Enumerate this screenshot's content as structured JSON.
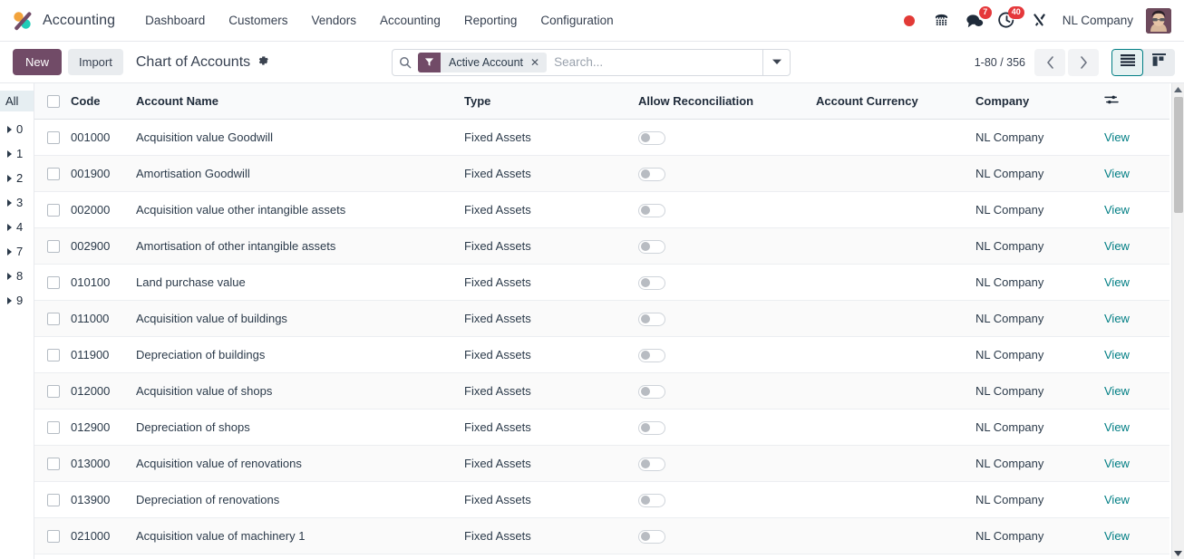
{
  "navbar": {
    "brand": "Accounting",
    "logo_icon": "odoo-accounting-logo-icon",
    "menu": [
      {
        "label": "Dashboard"
      },
      {
        "label": "Customers"
      },
      {
        "label": "Vendors"
      },
      {
        "label": "Accounting"
      },
      {
        "label": "Reporting"
      },
      {
        "label": "Configuration"
      }
    ],
    "status_icons": [
      {
        "name": "recording-dot-icon",
        "badge": ""
      },
      {
        "name": "voip-phone-icon",
        "badge": ""
      },
      {
        "name": "messages-icon",
        "badge": "7"
      },
      {
        "name": "activities-clock-icon",
        "badge": "40"
      },
      {
        "name": "debug-tools-icon",
        "badge": ""
      }
    ],
    "company": "NL Company",
    "avatar_name": "user-avatar"
  },
  "control_panel": {
    "new_label": "New",
    "import_label": "Import",
    "breadcrumb": "Chart of Accounts",
    "gear_icon": "gear-icon",
    "search": {
      "search_icon": "search-icon",
      "facet_icon": "filter-funnel-icon",
      "facet_label": "Active Account",
      "facet_remove": "✕",
      "placeholder": "Search...",
      "value": "",
      "dropdown_icon": "chevron-down-icon"
    },
    "pager": {
      "count": "1-80 / 356",
      "prev_icon": "chevron-left-icon",
      "next_icon": "chevron-right-icon"
    },
    "view_switcher": [
      {
        "name": "list-view",
        "icon": "list-icon",
        "active": true
      },
      {
        "name": "kanban-view",
        "icon": "kanban-icon",
        "active": false
      }
    ]
  },
  "sidebar": {
    "all_label": "All",
    "items": [
      {
        "label": "0"
      },
      {
        "label": "1"
      },
      {
        "label": "2"
      },
      {
        "label": "3"
      },
      {
        "label": "4"
      },
      {
        "label": "7"
      },
      {
        "label": "8"
      },
      {
        "label": "9"
      }
    ]
  },
  "table": {
    "columns": {
      "code": "Code",
      "name": "Account Name",
      "type": "Type",
      "reconciliation": "Allow Reconciliation",
      "currency": "Account Currency",
      "company": "Company"
    },
    "options_icon": "column-settings-icon",
    "view_label": "View",
    "rows": [
      {
        "code": "001000",
        "name": "Acquisition value Goodwill",
        "type": "Fixed Assets",
        "reconcile": false,
        "currency": "",
        "company": "NL Company",
        "view": "View"
      },
      {
        "code": "001900",
        "name": "Amortisation Goodwill",
        "type": "Fixed Assets",
        "reconcile": false,
        "currency": "",
        "company": "NL Company",
        "view": "View"
      },
      {
        "code": "002000",
        "name": "Acquisition value other intangible assets",
        "type": "Fixed Assets",
        "reconcile": false,
        "currency": "",
        "company": "NL Company",
        "view": "View"
      },
      {
        "code": "002900",
        "name": "Amortisation of other intangible assets",
        "type": "Fixed Assets",
        "reconcile": false,
        "currency": "",
        "company": "NL Company",
        "view": "View"
      },
      {
        "code": "010100",
        "name": "Land purchase value",
        "type": "Fixed Assets",
        "reconcile": false,
        "currency": "",
        "company": "NL Company",
        "view": "View"
      },
      {
        "code": "011000",
        "name": "Acquisition value of buildings",
        "type": "Fixed Assets",
        "reconcile": false,
        "currency": "",
        "company": "NL Company",
        "view": "View"
      },
      {
        "code": "011900",
        "name": "Depreciation of buildings",
        "type": "Fixed Assets",
        "reconcile": false,
        "currency": "",
        "company": "NL Company",
        "view": "View"
      },
      {
        "code": "012000",
        "name": "Acquisition value of shops",
        "type": "Fixed Assets",
        "reconcile": false,
        "currency": "",
        "company": "NL Company",
        "view": "View"
      },
      {
        "code": "012900",
        "name": "Depreciation of shops",
        "type": "Fixed Assets",
        "reconcile": false,
        "currency": "",
        "company": "NL Company",
        "view": "View"
      },
      {
        "code": "013000",
        "name": "Acquisition value of renovations",
        "type": "Fixed Assets",
        "reconcile": false,
        "currency": "",
        "company": "NL Company",
        "view": "View"
      },
      {
        "code": "013900",
        "name": "Depreciation of renovations",
        "type": "Fixed Assets",
        "reconcile": false,
        "currency": "",
        "company": "NL Company",
        "view": "View"
      },
      {
        "code": "021000",
        "name": "Acquisition value of machinery 1",
        "type": "Fixed Assets",
        "reconcile": false,
        "currency": "",
        "company": "NL Company",
        "view": "View"
      }
    ]
  },
  "colors": {
    "brand_purple": "#714b67",
    "link_teal": "#017e84",
    "badge_red": "#e5383b",
    "record_red": "#e23a36"
  }
}
